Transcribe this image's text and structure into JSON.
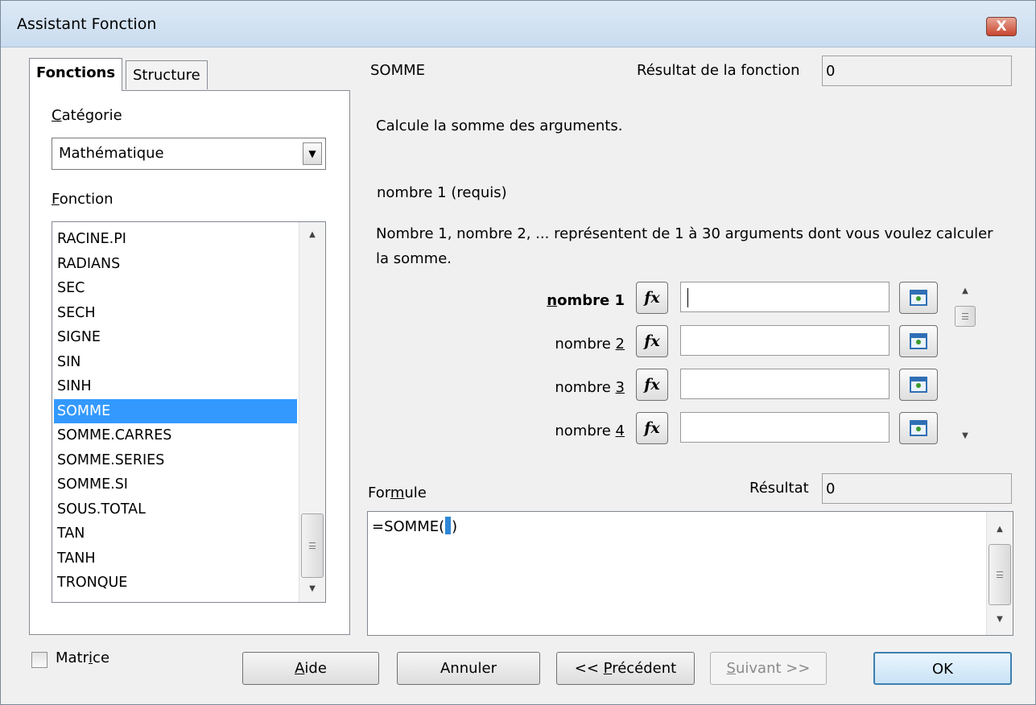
{
  "window": {
    "title": "Assistant Fonction",
    "close_label": "X"
  },
  "tabs": [
    {
      "label": "Fonctions"
    },
    {
      "label": "Structure"
    }
  ],
  "left": {
    "category_label": "Catégorie",
    "category_value": "Mathématique",
    "function_label": "Fonction",
    "functions": [
      "RACINE.PI",
      "RADIANS",
      "SEC",
      "SECH",
      "SIGNE",
      "SIN",
      "SINH",
      "SOMME",
      "SOMME.CARRES",
      "SOMME.SERIES",
      "SOMME.SI",
      "SOUS.TOTAL",
      "TAN",
      "TANH",
      "TRONQUE"
    ],
    "selected_function": "SOMME"
  },
  "right": {
    "function_name": "SOMME",
    "function_result_label": "Résultat de la fonction",
    "function_result_value": "0",
    "description": "Calcule la somme des arguments.",
    "arg_title": "nombre 1 (requis)",
    "arg_description": "Nombre 1, nombre 2, ... représentent de 1 à 30 arguments dont vous voulez calculer la somme.",
    "args": [
      {
        "label": "nombre 1",
        "value": ""
      },
      {
        "label": "nombre 2",
        "value": ""
      },
      {
        "label": "nombre 3",
        "value": ""
      },
      {
        "label": "nombre 4",
        "value": ""
      }
    ],
    "fx_label": "fx",
    "formula_label": "Formule",
    "result_label": "Résultat",
    "result_value": "0",
    "formula_before": "=SOMME(",
    "formula_after": ")"
  },
  "footer": {
    "matrix_label": "Matrice",
    "help": "Aide",
    "cancel": "Annuler",
    "previous": "<< Précédent",
    "next": "Suivant >>",
    "ok": "OK"
  }
}
